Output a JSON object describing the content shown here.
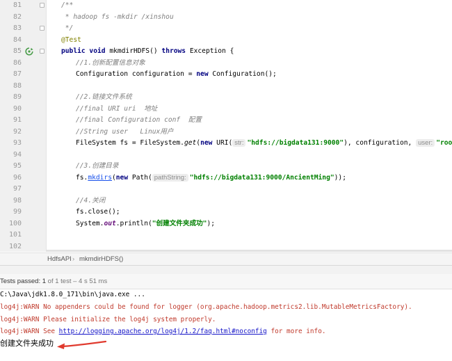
{
  "editor": {
    "line_numbers": [
      "81",
      "82",
      "83",
      "84",
      "85",
      "86",
      "87",
      "88",
      "89",
      "90",
      "91",
      "92",
      "93",
      "94",
      "95",
      "96",
      "97",
      "98",
      "99",
      "100",
      "101",
      "102"
    ],
    "l81": "/**",
    "l82": " * hadoop fs -mkdir /xinshou",
    "l83": " */",
    "l84": "@Test",
    "l85_kw1": "public void",
    "l85_mid": " mkmdirHDFS() ",
    "l85_kw2": "throws",
    "l85_end": " Exception {",
    "l86": "//1.创新配置信息对象",
    "l87_a": "Configuration configuration = ",
    "l87_kw": "new",
    "l87_b": " Configuration();",
    "l89": "//2.链接文件系统",
    "l90": "//final URI uri  地址",
    "l91": "//final Configuration conf  配置",
    "l92": "//String user   Linux用户",
    "l93_a": "FileSystem fs = FileSystem.",
    "l93_get": "get",
    "l93_b": "(",
    "l93_kw": "new",
    "l93_c": " URI(",
    "l93_hint1": "str:",
    "l93_str1": "\"hdfs://bigdata131:9000\"",
    "l93_d": "), configuration, ",
    "l93_hint2": "user:",
    "l93_str2": "\"root\"",
    "l93_e": ");",
    "l95": "//3.创建目录",
    "l96_a": "fs.",
    "l96_m": "mkdirs",
    "l96_b": "(",
    "l96_kw": "new",
    "l96_c": " Path(",
    "l96_hint": "pathString:",
    "l96_str": "\"hdfs://bigdata131:9000/AncientMing\"",
    "l96_d": "));",
    "l98": "//4.关闭",
    "l99": "fs.close();",
    "l100_a": "System.",
    "l100_out": "out",
    "l100_b": ".println(",
    "l100_str": "\"创建文件夹成功\"",
    "l100_c": ");"
  },
  "breadcrumb": {
    "class": "HdfsAPI",
    "sep": "›",
    "method": "mkmdirHDFS()"
  },
  "status": {
    "label": "Tests passed: 1",
    "detail": " of 1 test – 4 s 51 ms"
  },
  "console": {
    "cmd": "C:\\Java\\jdk1.8.0_171\\bin\\java.exe ...",
    "warn1": "log4j:WARN No appenders could be found for logger (org.apache.hadoop.metrics2.lib.MutableMetricsFactory).",
    "warn2": "log4j:WARN Please initialize the log4j system properly.",
    "warn3_pre": "log4j:WARN See ",
    "warn3_link": "http://logging.apache.org/log4j/1.2/faq.html#noconfig",
    "warn3_post": " for more info.",
    "output": "创建文件夹成功"
  },
  "colors": {
    "arrow": "#e03a2e",
    "string": "#008000",
    "keyword": "#000080",
    "comment": "#808080",
    "annotation": "#808000"
  }
}
